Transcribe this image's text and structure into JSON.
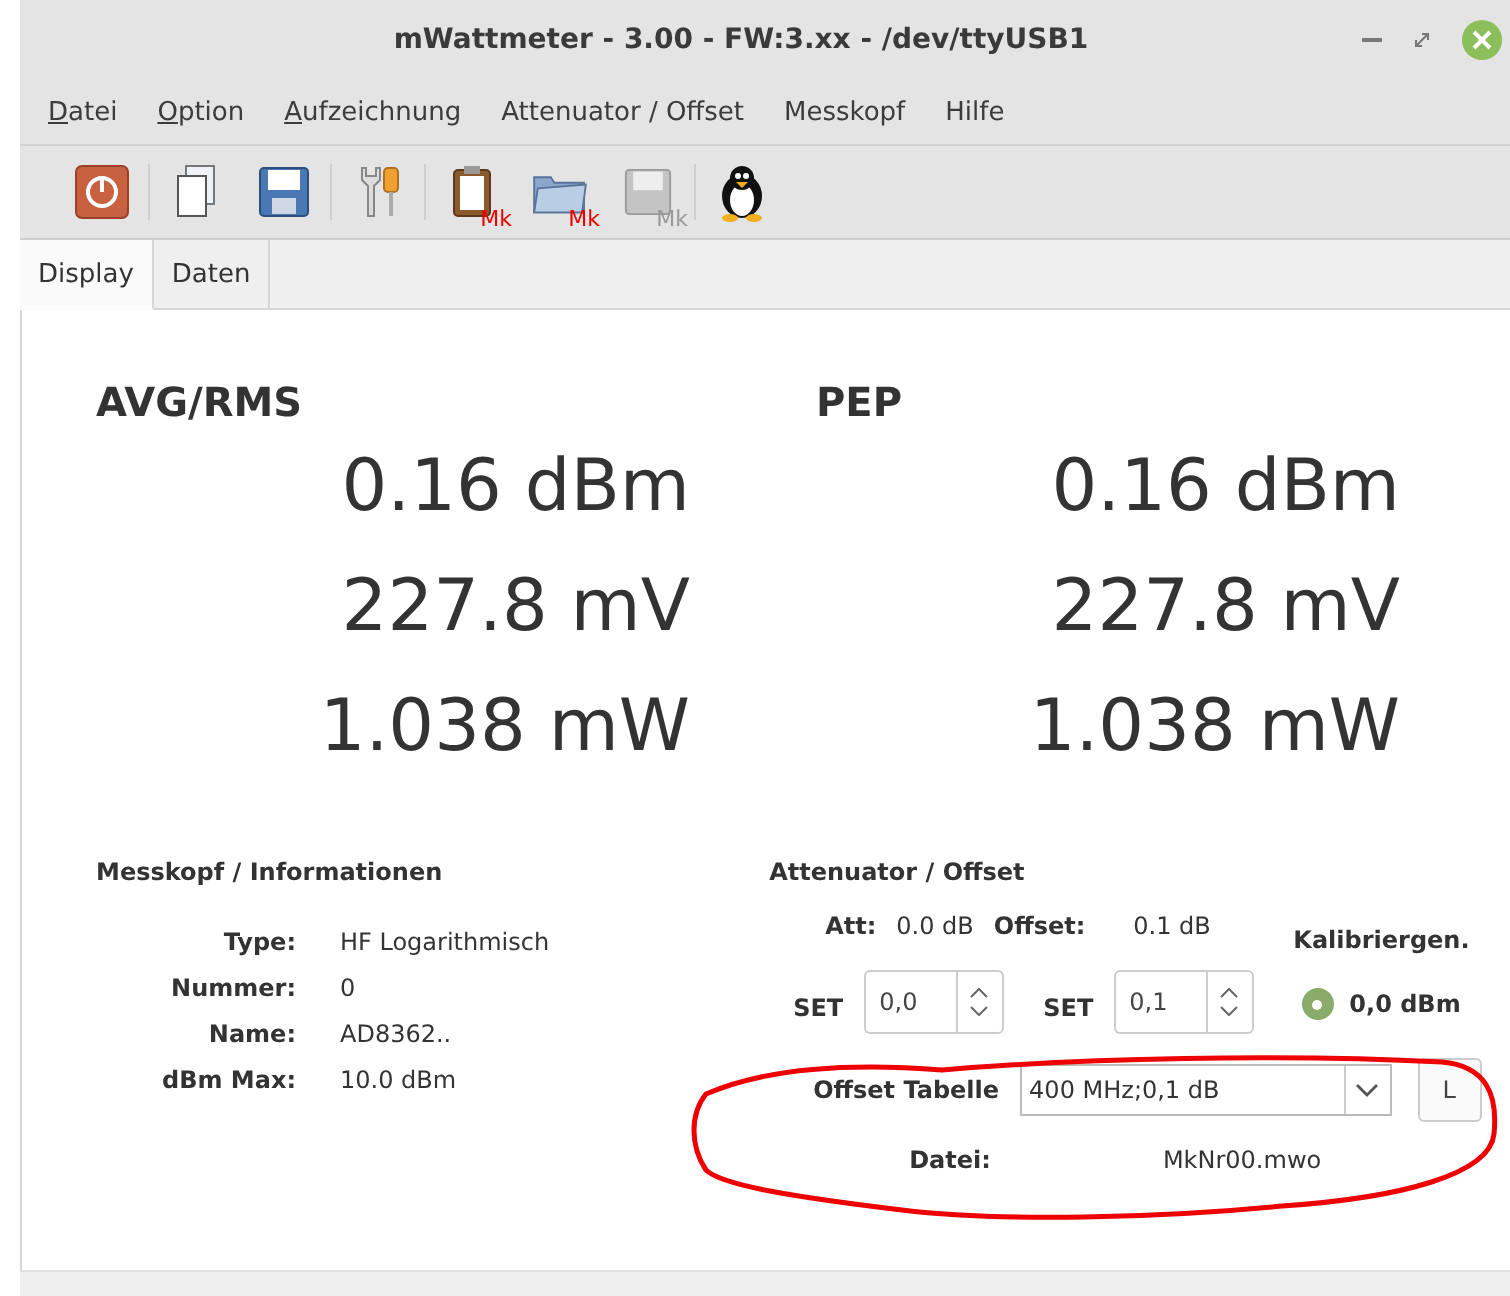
{
  "window": {
    "title": "mWattmeter - 3.00 - FW:3.xx - /dev/ttyUSB1"
  },
  "menu": [
    {
      "label": "Datei",
      "mnemonic": true
    },
    {
      "label": "Option",
      "mnemonic": true
    },
    {
      "label": "Aufzeichnung",
      "mnemonic": true
    },
    {
      "label": "Attenuator / Offset",
      "mnemonic": false
    },
    {
      "label": "Messkopf",
      "mnemonic": false
    },
    {
      "label": "Hilfe",
      "mnemonic": false
    }
  ],
  "toolbar": [
    [
      {
        "kind": "power"
      }
    ],
    [
      {
        "kind": "copy"
      },
      {
        "kind": "save"
      }
    ],
    [
      {
        "kind": "tools"
      }
    ],
    [
      {
        "kind": "clipboard",
        "label": "Mk",
        "disabled": false
      },
      {
        "kind": "folder",
        "label": "Mk",
        "disabled": false
      },
      {
        "kind": "disk",
        "label": "Mk",
        "disabled": true
      }
    ],
    [
      {
        "kind": "penguin"
      }
    ]
  ],
  "tabs": [
    {
      "label": "Display",
      "selected": true
    },
    {
      "label": "Daten",
      "selected": false
    }
  ],
  "readings": [
    {
      "title": "AVG/RMS",
      "values": [
        "0.16 dBm",
        "227.8 mV",
        "1.038 mW"
      ]
    },
    {
      "title": "PEP",
      "values": [
        "0.16 dBm",
        "227.8 mV",
        "1.038 mW"
      ]
    }
  ],
  "messkopf": {
    "title": "Messkopf / Informationen",
    "rows": [
      {
        "label": "Type:",
        "value": "HF Logarithmisch"
      },
      {
        "label": "Nummer:",
        "value": "0"
      },
      {
        "label": "Name:",
        "value": "AD8362.."
      },
      {
        "label": "dBm Max:",
        "value": "10.0 dBm"
      }
    ]
  },
  "attenuator": {
    "title": "Attenuator / Offset",
    "att_label": "Att:",
    "att_value": "0.0 dB",
    "offset_label": "Offset:",
    "offset_value": "0.1 dB",
    "spinboxes": [
      {
        "label": "SET",
        "value": "0,0"
      },
      {
        "label": "SET",
        "value": "0,1"
      }
    ],
    "calibration": {
      "title": "Kalibriergen.",
      "label": "0,0 dBm",
      "selected": true
    },
    "offset_table": {
      "label": "Offset Tabelle",
      "value": "400 MHz;0,1 dB",
      "button": "L"
    },
    "file": {
      "label": "Datei:",
      "value": "MkNr00.mwo"
    }
  },
  "annotation": {
    "kind": "ellipse"
  }
}
